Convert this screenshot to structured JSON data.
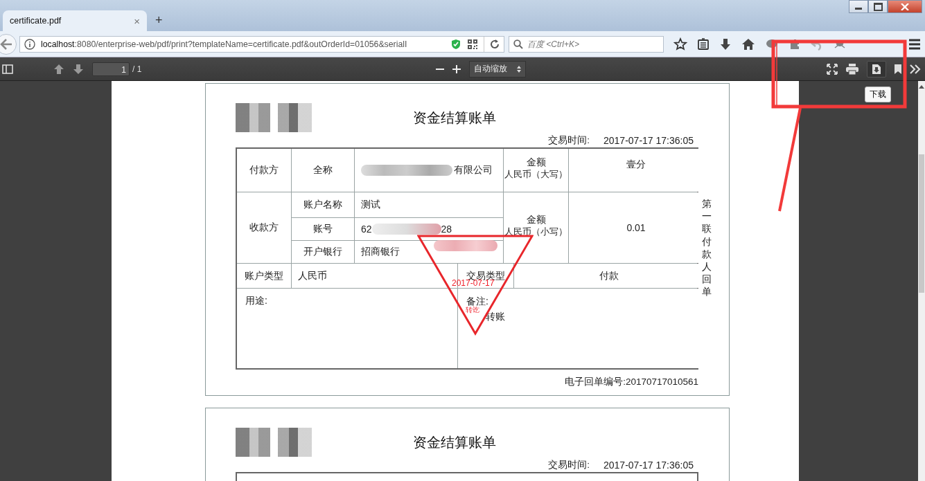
{
  "browser": {
    "tabs": [
      {
        "title": "certificate.pdf",
        "close": "×",
        "selected": true
      }
    ],
    "new_tab": "+",
    "address": {
      "host": "localhost",
      "rest": ":8080/enterprise-web/pdf/print?templateName=certificate.pdf&outOrderId=01056&serialI"
    },
    "search": {
      "placeholder": "百度 <Ctrl+K>"
    }
  },
  "pdf_toolbar": {
    "page": "1",
    "page_count": "/ 1",
    "zoom": "自动缩放",
    "tooltip": "下载"
  },
  "receipts": [
    {
      "title": "资金结算账单",
      "time_label": "交易时间:",
      "time": "2017-07-17 17:36:05",
      "payer_label": "付款方",
      "full_name_label": "全称",
      "full_name": "有限公司",
      "amount_upper_label": "金额",
      "amount_upper_sub": "人民币（大写）",
      "amount_upper": "壹分",
      "payee_label": "收款方",
      "account_name_label": "账户名称",
      "account_name": "测试",
      "account_no_label": "账号",
      "account_no_start": "62",
      "account_no_end": "28",
      "bank_label": "开户银行",
      "bank": "招商银行",
      "amount_lower_label": "金额",
      "amount_lower_sub": "人民币（小写）",
      "amount_lower": "0.01",
      "account_type_label": "账户类型",
      "account_type": "人民币",
      "trade_type_label": "交易类型",
      "trade_type": "付款",
      "purpose_label": "用途:",
      "note_label": "备注:",
      "note": "转账",
      "side_label": "第一联付款人回单",
      "serial_label": "电子回单编号:",
      "serial": "20170717010561",
      "stamp": {
        "date": "2017-07-17",
        "mark": "转讫"
      }
    },
    {
      "title": "资金结算账单",
      "time_label": "交易时间:",
      "time": "2017-07-17 17:36:05"
    }
  ]
}
